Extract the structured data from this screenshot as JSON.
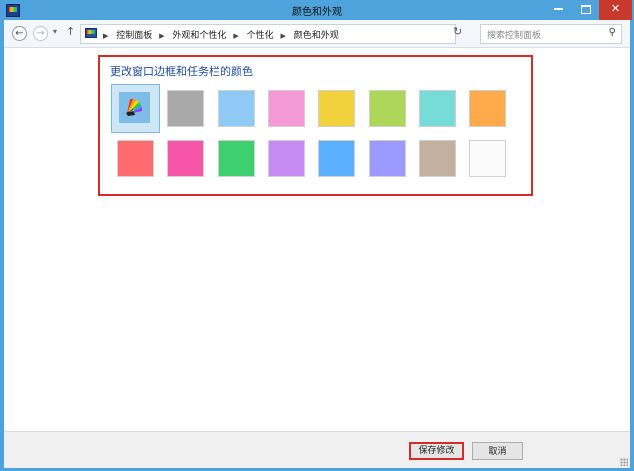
{
  "window": {
    "title": "颜色和外观",
    "minimize_glyph": "─",
    "close_glyph": "✕"
  },
  "nav": {
    "back_glyph": "←",
    "forward_glyph": "→",
    "up_glyph": "↑",
    "breadcrumbs": [
      "控制面板",
      "外观和个性化",
      "个性化",
      "颜色和外观"
    ],
    "search_placeholder": "搜索控制面板",
    "refresh_glyph": "↻",
    "search_glyph": "⚲"
  },
  "content": {
    "heading": "更改窗口边框和任务栏的颜色",
    "swatches_row1": [
      "auto",
      "#a9a9a9",
      "#8fcaf6",
      "#f49ad6",
      "#f2d23c",
      "#aed75a",
      "#77dbd8",
      "#ffab4b"
    ],
    "swatches_row2": [
      "#ff6b6f",
      "#f556a8",
      "#3ecf70",
      "#c78af5",
      "#5ab0ff",
      "#9b9bff",
      "#c4b09e",
      "#fbfbfb"
    ],
    "selected_index": 0
  },
  "footer": {
    "save_label": "保存修改",
    "cancel_label": "取消"
  },
  "colors": {
    "accent_frame": "#4fa3dc",
    "highlight_border": "#d62b2b",
    "heading": "#1e4aa0"
  }
}
